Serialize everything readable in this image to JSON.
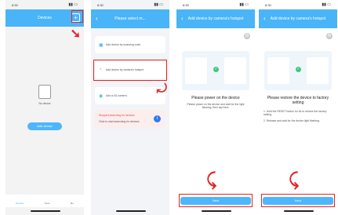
{
  "colors": {
    "accent": "#49b4f7",
    "highlight": "#e52424"
  },
  "p1": {
    "time": "8:30",
    "title": "Devices",
    "add_icon": "plus-icon",
    "empty_label": "No device",
    "add_btn": "Add device",
    "tabs": [
      "Devices",
      "Store",
      "Me"
    ]
  },
  "p2": {
    "time": "8:30",
    "title": "Please select m...",
    "opt1": "Add device by scanning code",
    "opt2": "Add device by camera's hotspot",
    "opt3": "Add a 4G camera",
    "warn1": "Stopped searching for devices",
    "warn2": "Click to start searching for devices"
  },
  "p3": {
    "time": "8:30",
    "title": "Add device by camera's hotspot",
    "heading": "Please power on the device",
    "body": "Please power on the device and wait for the light flashing, then tap Next.",
    "next": "Next"
  },
  "p4": {
    "time": "8:30",
    "title": "Add device by camera's hotspot",
    "heading": "Please restore the device to factory setting",
    "line1": "1. Hold the RESET button for 5s to restore the factory setting.",
    "line2": "2. Release and wait for the device light flashing.",
    "next": "Next"
  }
}
